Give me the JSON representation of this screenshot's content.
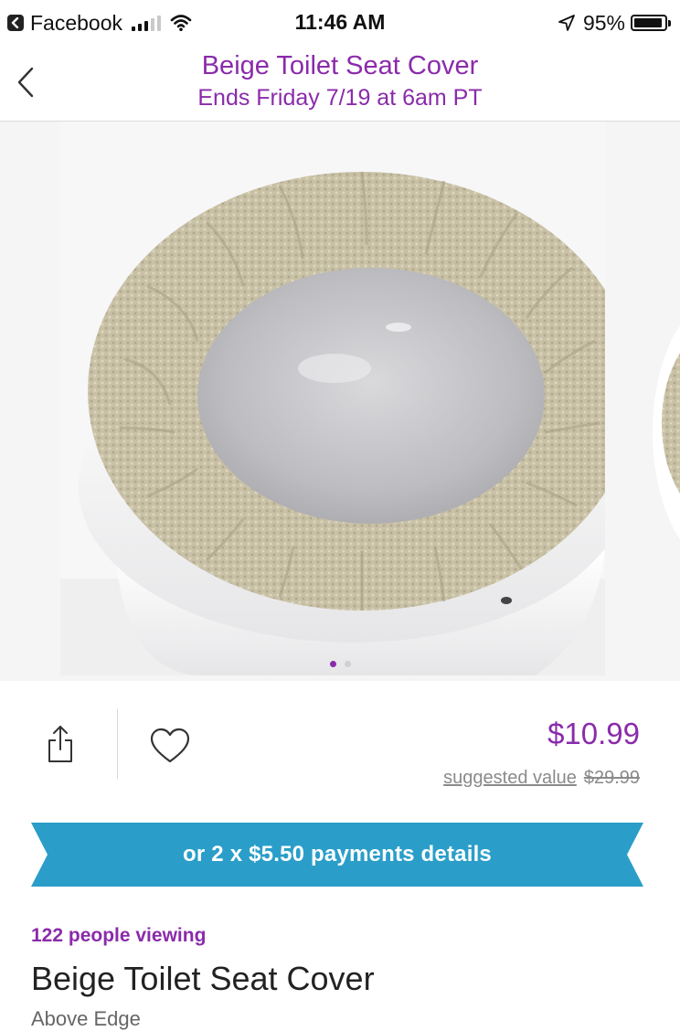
{
  "status_bar": {
    "back_app": "Facebook",
    "time": "11:46 AM",
    "battery_percent": "95%",
    "battery_level": 0.95,
    "icons": [
      "back-arrow-icon",
      "signal-icon",
      "wifi-icon",
      "location-arrow-icon",
      "battery-icon"
    ]
  },
  "header": {
    "title": "Beige Toilet Seat Cover",
    "subtitle": "Ends Friday 7/19 at 6am PT",
    "back_icon": "chevron-left-icon"
  },
  "carousel": {
    "image_count": 2,
    "active_index": 0
  },
  "actions": {
    "share_icon": "share-icon",
    "favorite_icon": "heart-icon"
  },
  "pricing": {
    "price": "$10.99",
    "suggested_label": "suggested value",
    "suggested_value": "$29.99"
  },
  "payments": {
    "label": "or 2 x $5.50 payments details"
  },
  "product": {
    "viewers": "122 people viewing",
    "title": "Beige Toilet Seat Cover",
    "brand": "Above Edge"
  },
  "colors": {
    "accent_purple": "#8a2bab",
    "ribbon_blue": "#2a9ec9",
    "muted_text": "#8a8a8a"
  }
}
